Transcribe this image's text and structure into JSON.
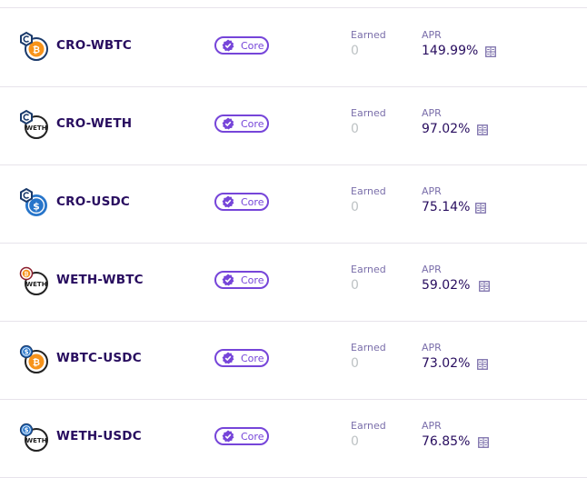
{
  "labels": {
    "badge": "Core",
    "earned": "Earned",
    "apr": "APR"
  },
  "colors": {
    "title": "#280d5f",
    "secondary": "#7a6eaa",
    "badge": "#7645d9",
    "disabled": "#bdc2c4",
    "cro": "#1a3a6b",
    "btc": "#f7931a",
    "usdc": "#2775ca",
    "weth": "#222222"
  },
  "farms": [
    {
      "pair": "CRO-WBTC",
      "tokens": [
        "cro-icon",
        "btc-icon"
      ],
      "earned": "0",
      "apr": "149.99%"
    },
    {
      "pair": "CRO-WETH",
      "tokens": [
        "cro-icon",
        "weth-icon"
      ],
      "earned": "0",
      "apr": "97.02%"
    },
    {
      "pair": "CRO-USDC",
      "tokens": [
        "cro-icon",
        "usdc-icon"
      ],
      "earned": "0",
      "apr": "75.14%"
    },
    {
      "pair": "WETH-WBTC",
      "tokens": [
        "btc-icon",
        "weth-icon"
      ],
      "earned": "0",
      "apr": "59.02%"
    },
    {
      "pair": "WBTC-USDC",
      "tokens": [
        "usdc-icon",
        "btc-icon"
      ],
      "earned": "0",
      "apr": "73.02%"
    },
    {
      "pair": "WETH-USDC",
      "tokens": [
        "usdc-icon",
        "weth-icon"
      ],
      "earned": "0",
      "apr": "76.85%"
    }
  ]
}
